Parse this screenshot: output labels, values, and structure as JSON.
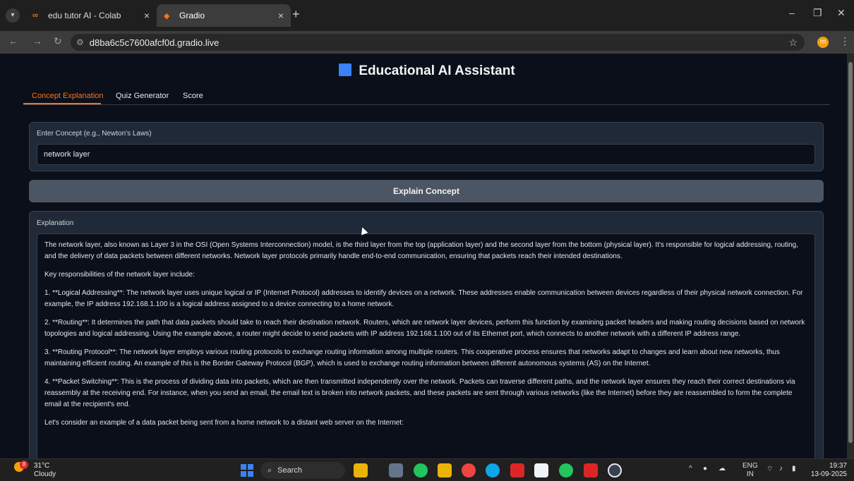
{
  "browser": {
    "tabs": [
      {
        "title": "edu tutor AI - Colab",
        "icon": "colab-icon"
      },
      {
        "title": "Gradio",
        "icon": "gradio-icon"
      }
    ],
    "url": "d8ba6c5c7600afcf0d.gradio.live",
    "profile_initial": "m"
  },
  "app": {
    "title": "Educational AI Assistant",
    "tabs": [
      {
        "label": "Concept Explanation",
        "active": true
      },
      {
        "label": "Quiz Generator",
        "active": false
      },
      {
        "label": "Score",
        "active": false
      }
    ],
    "concept": {
      "label": "Enter Concept (e.g., Newton's Laws)",
      "value": "network layer"
    },
    "explain_button": "Explain Concept",
    "explanation": {
      "label": "Explanation",
      "paragraphs": [
        "The network layer, also known as Layer 3 in the OSI (Open Systems Interconnection) model, is the third layer from the top (application layer) and the second layer from the bottom (physical layer). It's responsible for logical addressing, routing, and the delivery of data packets between different networks. Network layer protocols primarily handle end-to-end communication, ensuring that packets reach their intended destinations.",
        "Key responsibilities of the network layer include:",
        "1. **Logical Addressing**: The network layer uses unique logical or IP (Internet Protocol) addresses to identify devices on a network. These addresses enable communication between devices regardless of their physical network connection. For example, the IP address 192.168.1.100 is a logical address assigned to a device connecting to a home network.",
        "2. **Routing**: It determines the path that data packets should take to reach their destination network. Routers, which are network layer devices, perform this function by examining packet headers and making routing decisions based on network topologies and logical addressing. Using the example above, a router might decide to send packets with IP address 192.168.1.100 out of its Ethernet port, which connects to another network with a different IP address range.",
        "3. **Routing Protocol**: The network layer employs various routing protocols to exchange routing information among multiple routers. This cooperative process ensures that networks adapt to changes and learn about new networks, thus maintaining efficient routing. An example of this is the Border Gateway Protocol (BGP), which is used to exchange routing information between different autonomous systems (AS) on the Internet.",
        "4. **Packet Switching**: This is the process of dividing data into packets, which are then transmitted independently over the network. Packets can traverse different paths, and the network layer ensures they reach their correct destinations via reassembly at the receiving end. For instance, when you send an email, the email text is broken into network packets, and these packets are sent through various networks (like the Internet) before they are reassembled to form the complete email at the recipient's end.",
        "Let's consider an example of a data packet being sent from a home network to a distant web server on the Internet:"
      ]
    }
  },
  "taskbar": {
    "weather_temp": "31°C",
    "weather_desc": "Cloudy",
    "weather_badge": "8",
    "search_label": "Search",
    "lang_top": "ENG",
    "lang_bottom": "IN",
    "time": "19:37",
    "date": "13-09-2025"
  },
  "colors": {
    "accent": "#f97316",
    "page_bg": "#0b0f19",
    "block_bg": "#1f2937",
    "button_bg": "#4b5563"
  }
}
